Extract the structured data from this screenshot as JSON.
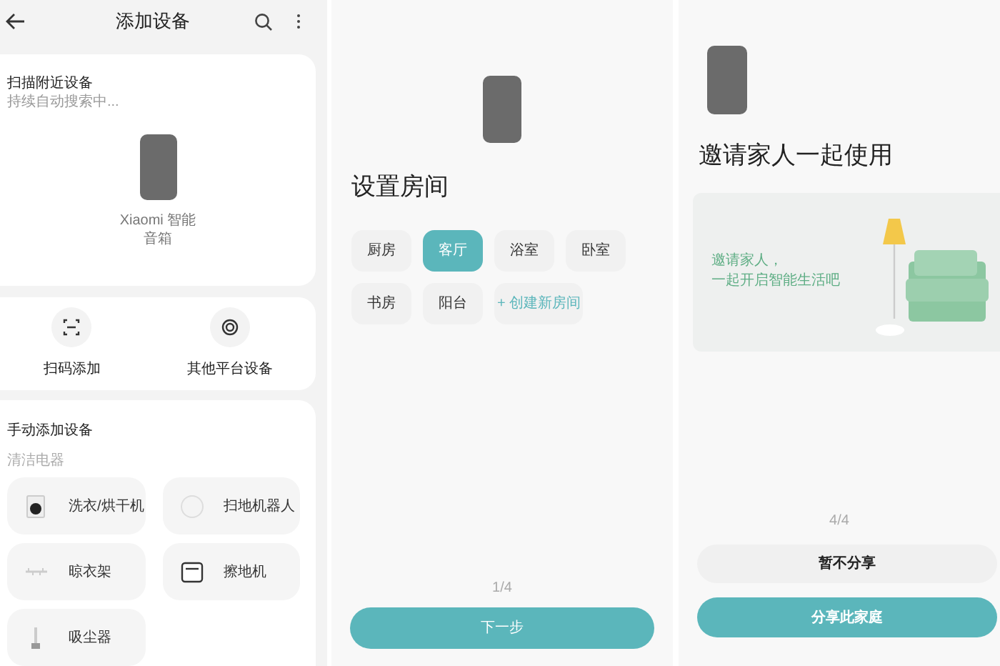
{
  "add_screen": {
    "title": "添加设备",
    "nearby": {
      "title": "扫描附近设备",
      "subtitle": "持续自动搜索中...",
      "device": "Xiaomi 智能音箱"
    },
    "quick_actions": [
      {
        "kind": "scan",
        "label": "扫码添加"
      },
      {
        "kind": "platform",
        "label": "其他平台设备"
      }
    ],
    "manual": {
      "title": "手动添加设备",
      "category": "清洁电器",
      "items": [
        {
          "kind": "washer",
          "label": "洗衣/烘干机"
        },
        {
          "kind": "robot",
          "label": "扫地机器人"
        },
        {
          "kind": "rack",
          "label": "晾衣架"
        },
        {
          "kind": "mop",
          "label": "擦地机"
        },
        {
          "kind": "vacuum",
          "label": "吸尘器"
        }
      ]
    }
  },
  "room_screen": {
    "title": "设置房间",
    "rooms": [
      {
        "kind": "room",
        "label": "厨房",
        "selected": false
      },
      {
        "kind": "room",
        "label": "客厅",
        "selected": true
      },
      {
        "kind": "room",
        "label": "浴室",
        "selected": false
      },
      {
        "kind": "room",
        "label": "卧室",
        "selected": false
      },
      {
        "kind": "room",
        "label": "书房",
        "selected": false
      },
      {
        "kind": "room",
        "label": "阳台",
        "selected": false
      },
      {
        "kind": "add",
        "label": "+ 创建新房间",
        "selected": false
      }
    ],
    "step": "1/4",
    "next_button": "下一步"
  },
  "share_screen": {
    "title": "邀请家人一起使用",
    "banner_lines": [
      "邀请家人，",
      "一起开启智能生活吧"
    ],
    "step": "4/4",
    "skip_button": "暂不分享",
    "share_button": "分享此家庭"
  }
}
